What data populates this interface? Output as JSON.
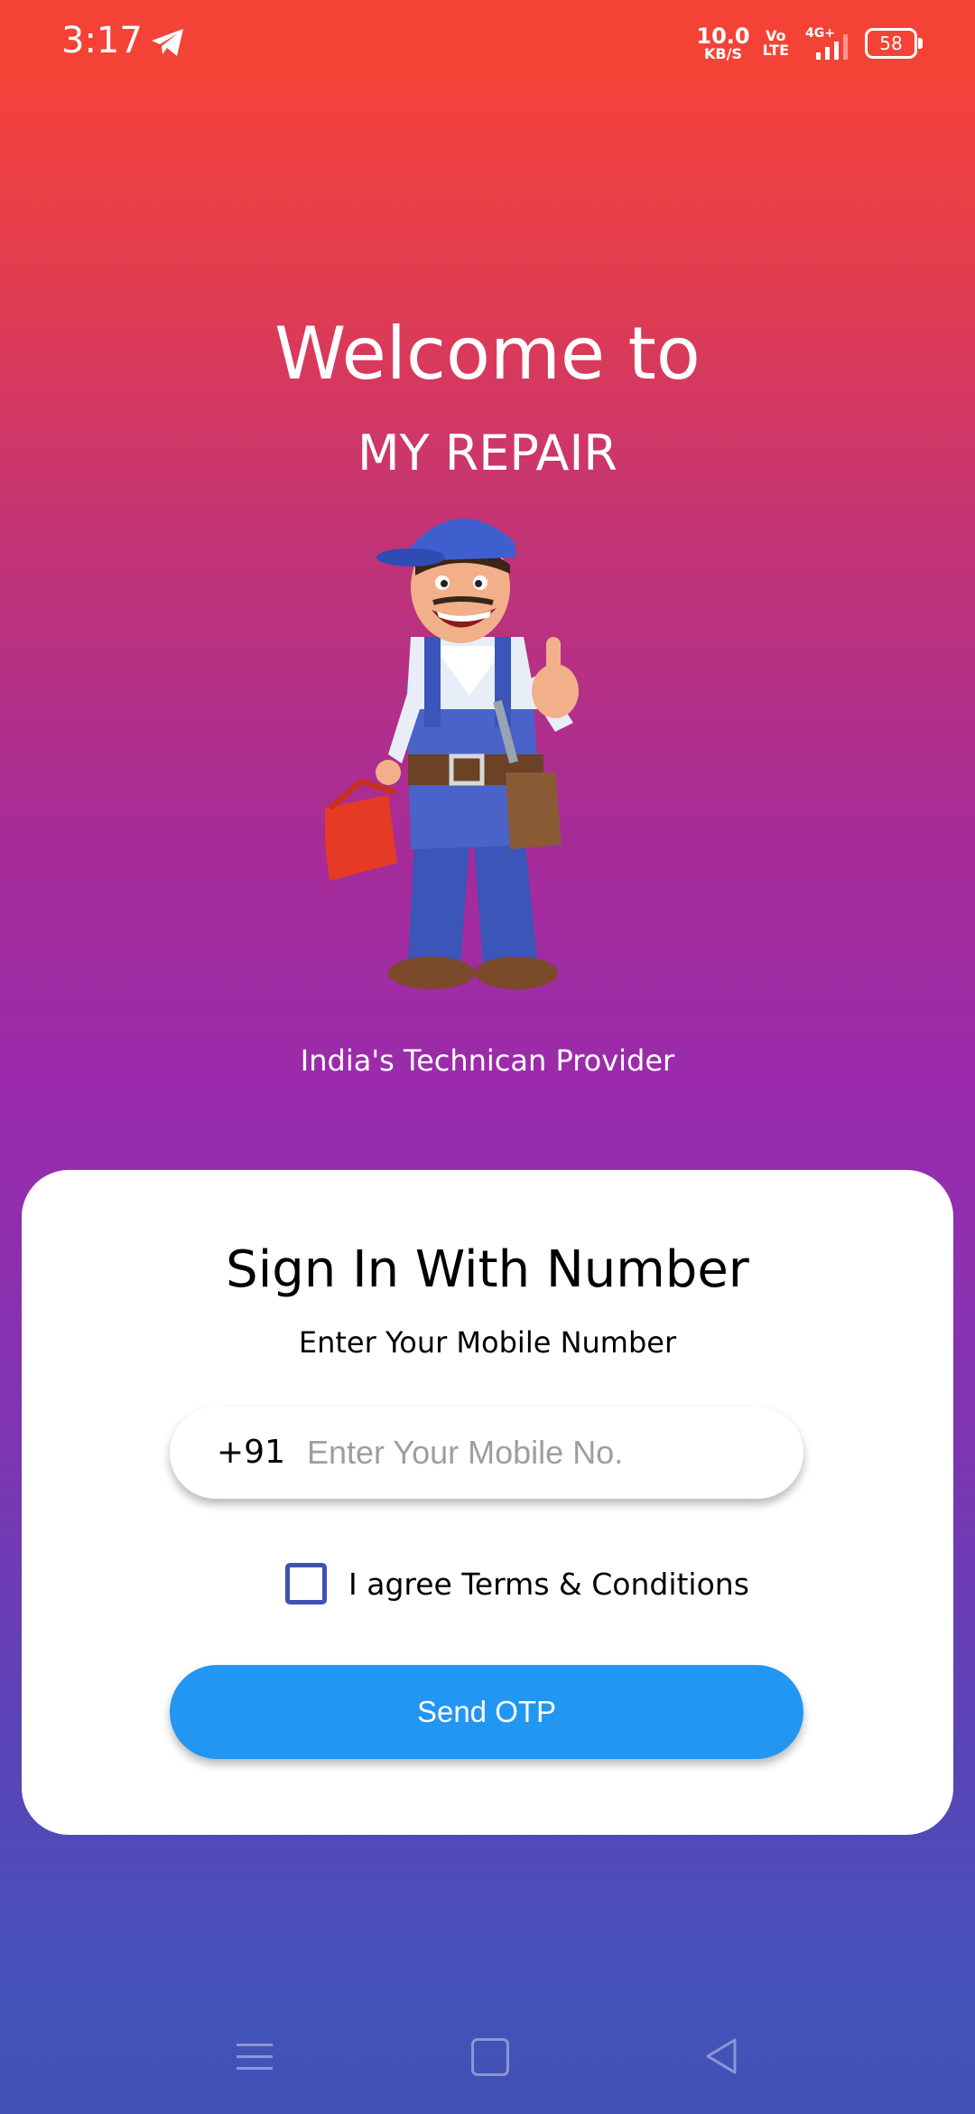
{
  "status_bar": {
    "time": "3:17",
    "net_speed_value": "10.0",
    "net_speed_unit": "KB/S",
    "volte_top": "Vo",
    "volte_bottom": "LTE",
    "network": "4G+",
    "battery": "58"
  },
  "header": {
    "welcome": "Welcome to",
    "brand": "MY REPAIR",
    "tagline": "India's Technican Provider"
  },
  "signin": {
    "title": "Sign In With Number",
    "subtitle": "Enter Your Mobile Number",
    "country_code": "+91",
    "phone_placeholder": "Enter Your Mobile No.",
    "phone_value": "",
    "terms_label": "I agree Terms & Conditions",
    "terms_checked": false,
    "send_button": "Send OTP"
  },
  "colors": {
    "status_bar": "#f44336",
    "accent_button": "#2196f3",
    "checkbox_border": "#3f51b5",
    "gradient_top": "#f44336",
    "gradient_mid": "#9c27b0",
    "gradient_bottom": "#3f51b5"
  },
  "icons": [
    "telegram-icon",
    "signal-icon",
    "battery-icon",
    "mascot-illustration",
    "menu-icon",
    "home-icon",
    "back-icon"
  ]
}
